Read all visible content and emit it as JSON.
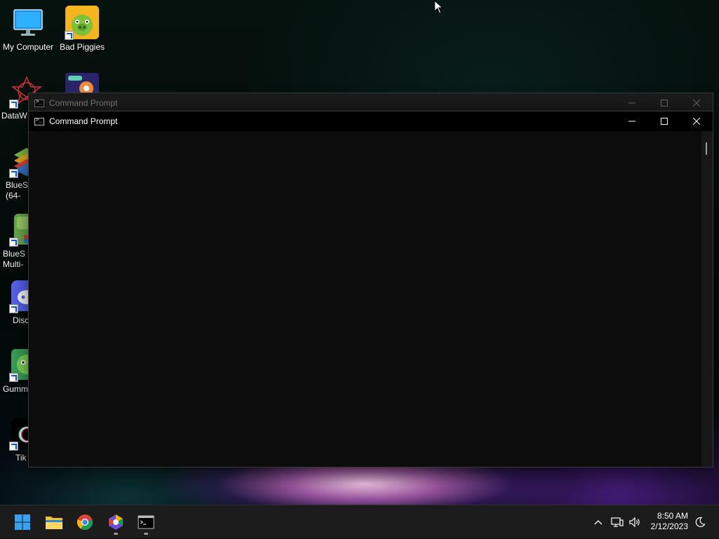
{
  "desktop": {
    "icons": [
      {
        "label": "My Computer"
      },
      {
        "label": "Bad Piggies"
      },
      {
        "label": "DataW"
      },
      {
        "label": "BlueS (64-"
      },
      {
        "label": "BlueS Multi-"
      },
      {
        "label": "Disc"
      },
      {
        "label": "Gumm"
      },
      {
        "label": "Tik"
      }
    ]
  },
  "windows": {
    "back": {
      "title": "Command Prompt"
    },
    "front": {
      "title": "Command Prompt"
    }
  },
  "taskbar": {
    "pinned": [
      "start-icon",
      "file-explorer-icon",
      "chrome-icon",
      "app-icon",
      "terminal-icon"
    ],
    "clock": {
      "time": "8:50 AM",
      "date": "2/12/2023"
    }
  },
  "colors": {
    "console_bg": "#0c0c0c",
    "taskbar_bg": "#1c1c1c",
    "accent_start": "#3aa0f0"
  }
}
